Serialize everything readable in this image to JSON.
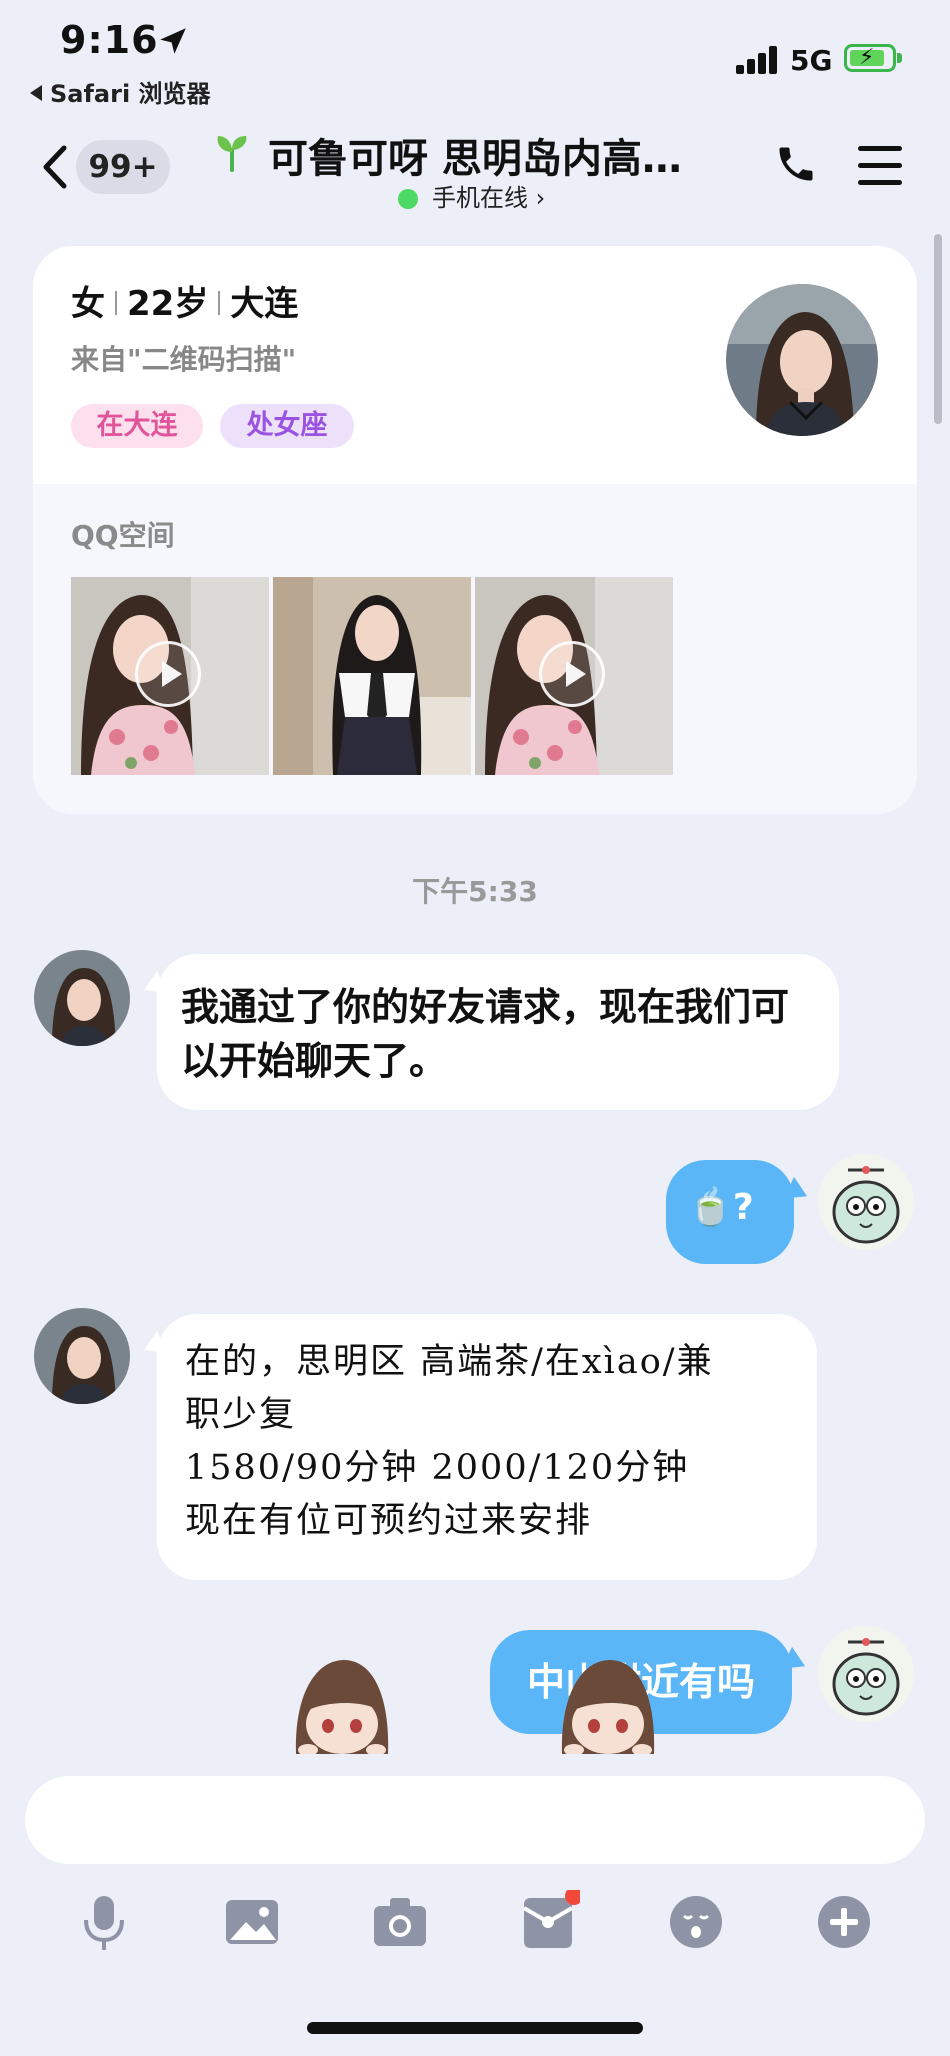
{
  "status_bar": {
    "time": "9:16",
    "back_app": "Safari 浏览器",
    "network": "5G"
  },
  "nav": {
    "unread_badge": "99+",
    "title": "可鲁可呀 思明岛内高…",
    "subtitle": "手机在线 ›"
  },
  "profile": {
    "gender": "女",
    "age": "22",
    "age_unit": "岁",
    "city": "大连",
    "source": "来自\"二维码扫描\"",
    "tags": [
      "在大连",
      "处女座"
    ],
    "qzone_label": "QQ空间"
  },
  "chat": {
    "timestamp": "下午5:33",
    "messages": [
      {
        "from": "them",
        "text": "我通过了你的好友请求，现在我们可以开始聊天了。"
      },
      {
        "from": "me",
        "emoji": "🍵",
        "text": "?"
      },
      {
        "from": "them",
        "lines": [
          "在的，思明区 高端茶/在xìao/兼",
          "职少复",
          "1580/90分钟 2000/120分钟",
          "现在有位可预约过来安排"
        ]
      },
      {
        "from": "me",
        "text": "中山附近有吗"
      }
    ]
  },
  "input": {
    "placeholder": ""
  },
  "colors": {
    "background": "#eceef8",
    "outgoing_bubble": "#5ab6f6",
    "incoming_bubble": "#ffffff",
    "tag_pink": "#e0549a",
    "tag_purple": "#9a52e0",
    "online_dot": "#4cd964",
    "notify_dot": "#f24a3a"
  },
  "toolbar_icons": [
    "microphone-icon",
    "image-icon",
    "camera-icon",
    "red-packet-icon",
    "emoji-icon",
    "plus-icon"
  ]
}
